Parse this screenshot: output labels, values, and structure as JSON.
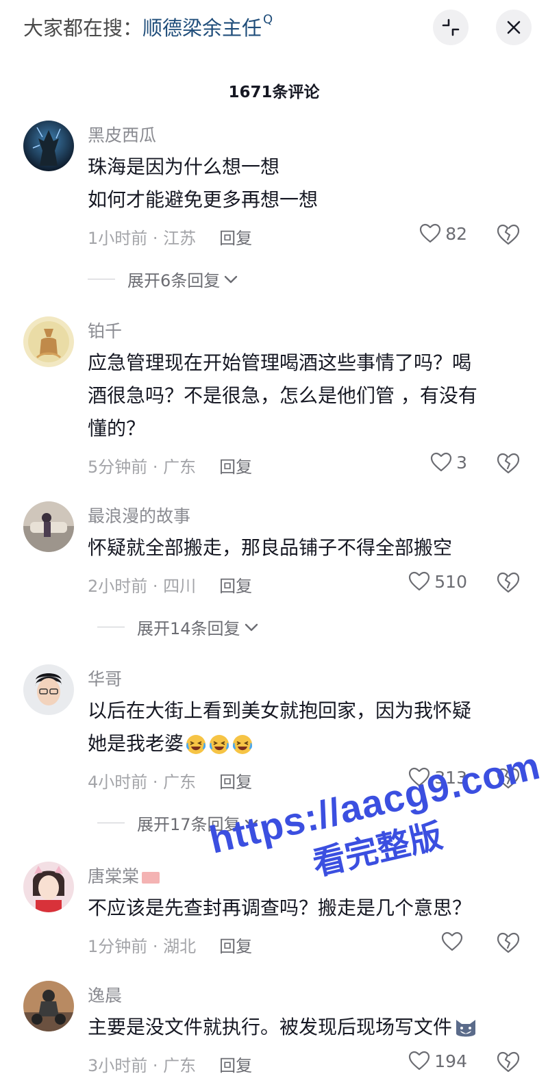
{
  "header": {
    "search_prefix": "大家都在搜：",
    "search_term": "顺德梁余主任",
    "search_q": "Q"
  },
  "comment_count": "1671条评论",
  "comments": [
    {
      "username": "黑皮西瓜",
      "lines": [
        "珠海是因为什么想一想",
        "如何才能避免更多再想一想"
      ],
      "time": "1小时前",
      "location": "江苏",
      "reply_label": "回复",
      "likes": "82",
      "expand": "展开6条回复"
    },
    {
      "username": "铂千",
      "lines": [
        "应急管理现在开始管理喝酒这些事情了吗？喝",
        "酒很急吗？不是很急，怎么是他们管 ，有没有",
        "懂的？"
      ],
      "time": "5分钟前",
      "location": "广东",
      "reply_label": "回复",
      "likes": "3"
    },
    {
      "username": "最浪漫的故事",
      "lines": [
        "怀疑就全部搬走，那良品铺子不得全部搬空"
      ],
      "time": "2小时前",
      "location": "四川",
      "reply_label": "回复",
      "likes": "510",
      "expand": "展开14条回复"
    },
    {
      "username": "华哥",
      "lines": [
        "以后在大街上看到美女就抱回家，因为我怀疑",
        "她是我老婆"
      ],
      "time": "4小时前",
      "location": "广东",
      "reply_label": "回复",
      "likes": "313",
      "expand": "展开17条回复"
    },
    {
      "username": "唐棠棠",
      "lines": [
        "不应该是先查封再调查吗？搬走是几个意思？"
      ],
      "time": "1分钟前",
      "location": "湖北",
      "reply_label": "回复",
      "likes": ""
    },
    {
      "username": "逸晨",
      "lines": [
        "主要是没文件就执行。被发现后现场写文件"
      ],
      "time": "3小时前",
      "location": "广东",
      "reply_label": "回复",
      "likes": "194"
    }
  ],
  "meta_separator": " · ",
  "watermark": {
    "url": "https://aacg9.com",
    "caption": "看完整版"
  },
  "colors": {
    "text": "#161823",
    "muted": "#8a8b91",
    "search_term": "#1f4d7a",
    "watermark": "#3b4fe0"
  },
  "icons": [
    "search-q-icon",
    "collapse-icon",
    "close-icon",
    "heart-icon",
    "broken-heart-icon",
    "chevron-down-icon",
    "laughing-crying-emoji",
    "cat-emoji"
  ]
}
